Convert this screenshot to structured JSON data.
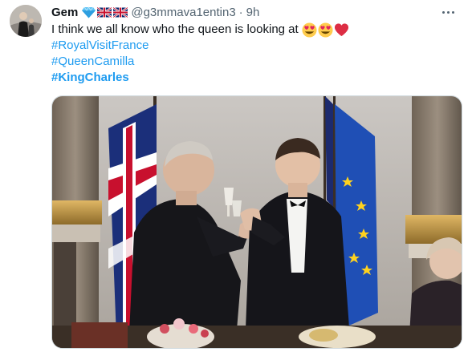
{
  "tweet": {
    "author": {
      "name": "Gem",
      "badges": [
        "gem-icon",
        "uk-flag-icon",
        "uk-flag-icon"
      ],
      "handle": "@g3mmava1entin3",
      "separator": "·",
      "time": "9h",
      "avatar": "avatar-photo"
    },
    "text_line": "I think we all know who the queen is looking at",
    "text_emojis": [
      "heart-eyes-icon",
      "heart-eyes-icon",
      "red-heart-icon"
    ],
    "hashtags": [
      {
        "label": "#RoyalVisitFrance",
        "bold": false
      },
      {
        "label": "#QueenCamilla",
        "bold": false
      },
      {
        "label": "#KingCharles",
        "bold": true
      }
    ],
    "more_icon": "more-dots-icon",
    "media": {
      "type": "photo",
      "subject": "two men in black tie toasting with glasses before UK, French and EU flags"
    }
  },
  "colors": {
    "accent": "#1d9bf0",
    "text": "#0f1419",
    "secondary": "#536471",
    "border": "#cfd9de"
  }
}
